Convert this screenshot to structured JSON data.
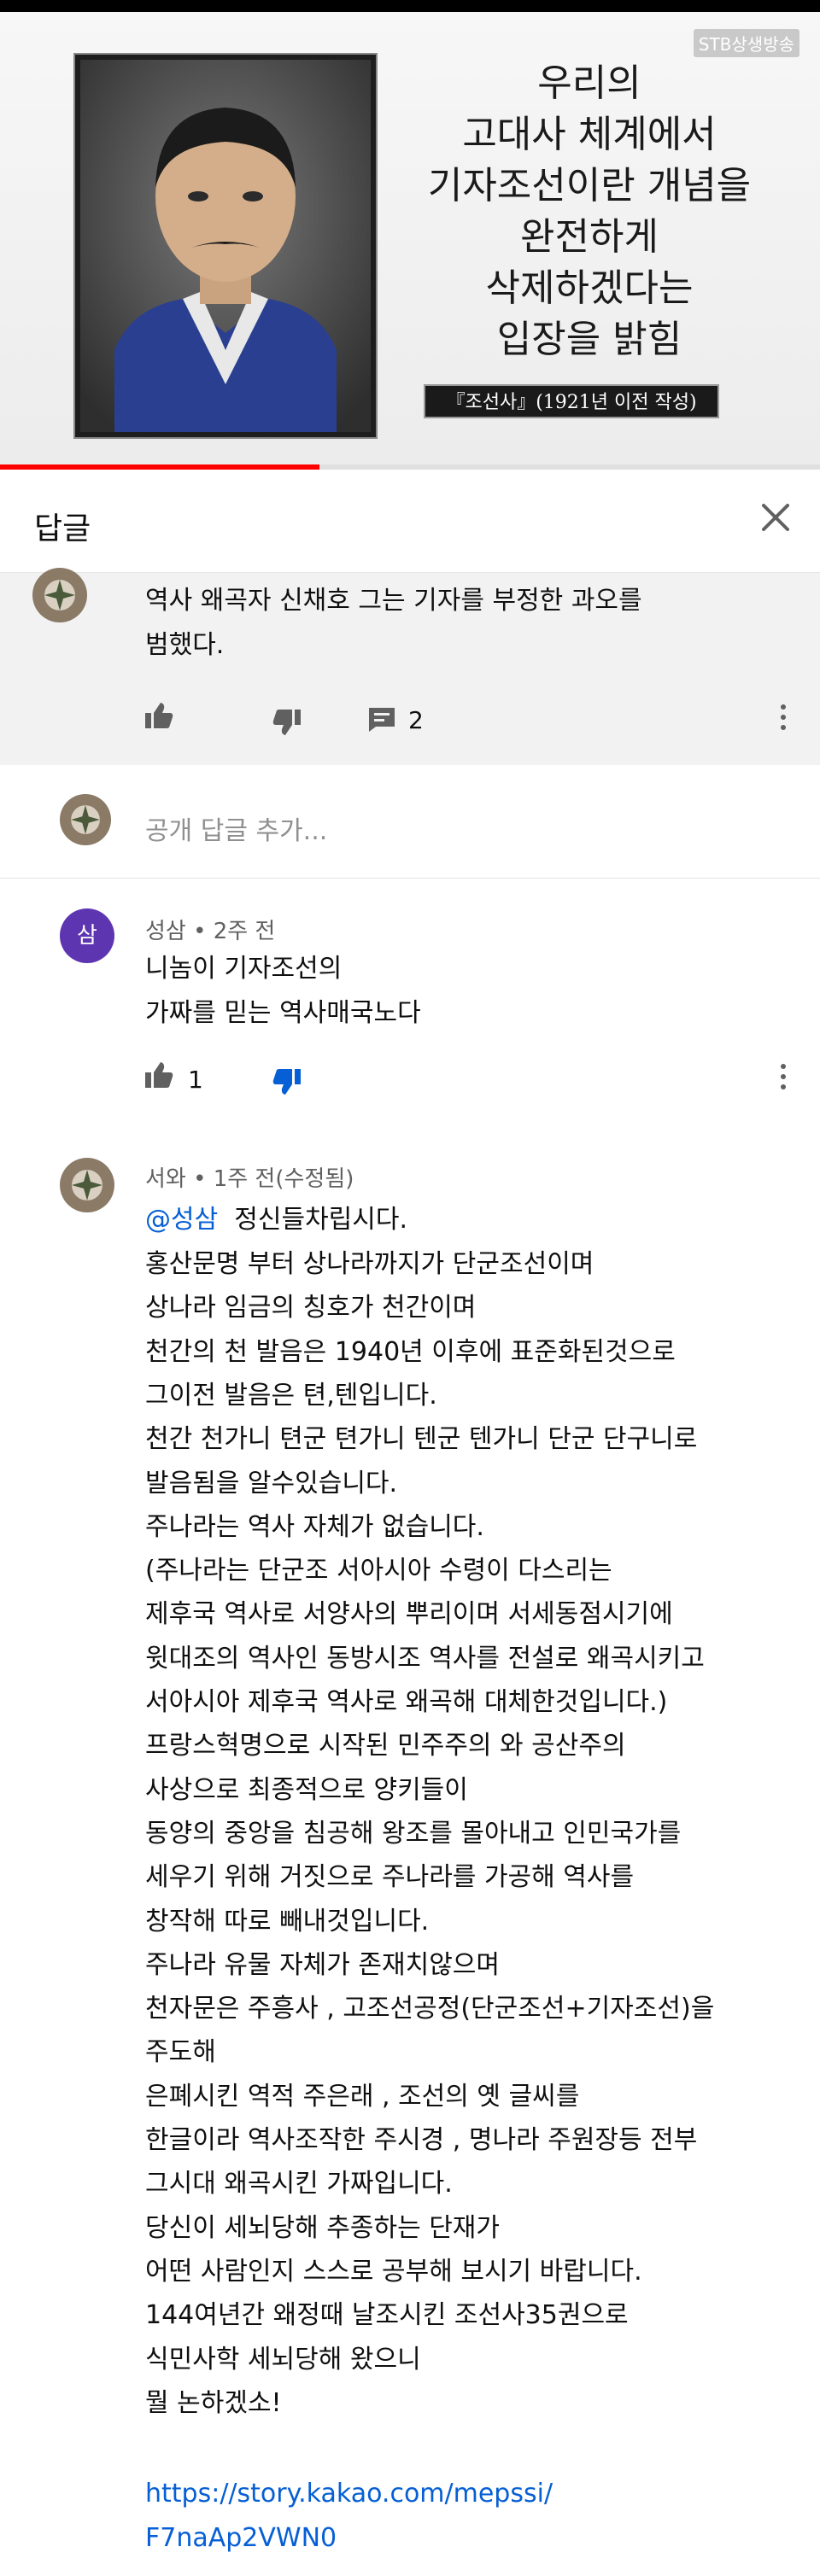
{
  "video": {
    "channel_badge": "STB상생방송",
    "headline_lines": [
      "우리의",
      "고대사 체계에서",
      "기자조선이란 개념을",
      "완전하게",
      "삭제하겠다는",
      "입장을 밝힘"
    ],
    "source_caption": "『조선사』(1921년 이전 작성)",
    "progress_fraction": 0.39
  },
  "panel": {
    "title": "답글",
    "close_icon": "close-icon"
  },
  "parent_comment": {
    "text_lines": [
      "역사 왜곡자 신채호 그는 기자를 부정한 과오를",
      "범했다."
    ],
    "reply_count": "2"
  },
  "add_reply": {
    "placeholder": "공개 답글 추가..."
  },
  "replies": [
    {
      "author_initial": "삼",
      "meta": "성삼 • 2주 전",
      "text_lines": [
        "니놈이 기자조선의",
        "가짜를 믿는 역사매국노다"
      ],
      "like_count": "1"
    },
    {
      "meta": "서와 • 1주 전(수정됨)",
      "mention": "@성삼",
      "first_line_rest": "  정신들차립시다.",
      "text_lines": [
        "홍산문명 부터 상나라까지가 단군조선이며",
        "상나라 임금의 칭호가 천간이며",
        "천간의 천 발음은 1940년 이후에 표준화된것으로",
        "그이전 발음은 텬,텐입니다.",
        "천간 천가니 텬군 텬가니 텐군 텐가니 단군 단구니로",
        "발음됨을 알수있습니다.",
        "주나라는 역사 자체가 없습니다.",
        "(주나라는 단군조 서아시아 수령이 다스리는",
        "제후국 역사로 서양사의 뿌리이며 서세동점시기에",
        "윗대조의 역사인 동방시조 역사를 전설로 왜곡시키고",
        "서아시아 제후국 역사로 왜곡해 대체한것입니다.)",
        "프랑스혁명으로 시작된 민주주의 와 공산주의",
        "사상으로 최종적으로 양키들이",
        "동양의 중앙을 침공해 왕조를 몰아내고 인민국가를",
        "세우기 위해 거짓으로 주나라를 가공해 역사를",
        "창작해 따로 빼내것입니다.",
        "주나라 유물 자체가 존재치않으며",
        "천자문은 주흥사 , 고조선공정(단군조선+기자조선)을",
        "주도해",
        "은폐시킨 역적 주은래 , 조선의 옛 글씨를",
        "한글이라 역사조작한 주시경 , 명나라 주원장등  전부",
        "그시대 왜곡시킨 가짜입니다.",
        "당신이 세뇌당해 추종하는 단재가",
        "어떤 사람인지 스스로 공부해 보시기 바랍니다.",
        "144여년간 왜정때 날조시킨 조선사35권으로",
        "식민사학 세뇌당해 왔으니",
        "뭘 논하겠소!"
      ],
      "link_lines": [
        "https://story.kakao.com/mepssi/",
        "F7naAp2VWN0"
      ]
    }
  ]
}
